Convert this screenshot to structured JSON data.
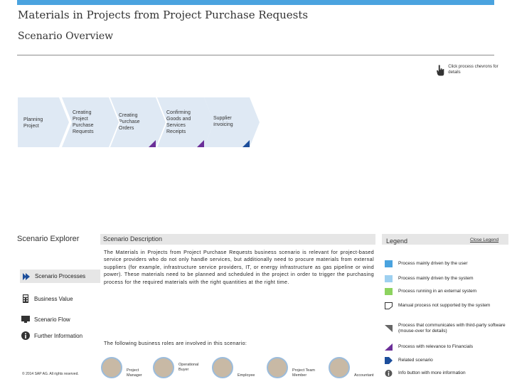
{
  "header": {
    "title": "Materials in Projects from Project Purchase Requests",
    "subtitle": "Scenario Overview",
    "hint": "Click process chevrons for details"
  },
  "flow": {
    "steps": [
      {
        "label": "Planning Project"
      },
      {
        "label": "Creating Project Purchase Requests"
      },
      {
        "label": "Creating Purchase Orders"
      },
      {
        "label": "Confirming Goods and Services Receipts"
      },
      {
        "label": "Supplier Invoicing"
      }
    ]
  },
  "explorer": {
    "title": "Scenario Explorer",
    "items": [
      {
        "label": "Scenario Processes",
        "icon": "arrow-icon"
      },
      {
        "label": "Business Value",
        "icon": "calculator-icon"
      },
      {
        "label": "Scenario Flow",
        "icon": "monitor-icon"
      },
      {
        "label": "Further Information",
        "icon": "info-icon"
      }
    ]
  },
  "description": {
    "heading": "Scenario Description",
    "text": "The Materials in Projects from Project Purchase Requests business scenario is relevant for project-based service providers who do not only handle services, but additionally need to procure materials from external suppliers (for example, infrastructure service providers, IT, or energy infrastructure as gas pipeline or wind power). These materials need to be planned and scheduled in the project in order to trigger the purchasing process for the required materials with the right quantities at the right time.",
    "roles_intro": "The following business roles are involved in this scenario:"
  },
  "roles": [
    {
      "label": "Project Manager"
    },
    {
      "label": "Operational Buyer"
    },
    {
      "label": "Employee"
    },
    {
      "label": "Project Team Member"
    },
    {
      "label": "Accountant"
    }
  ],
  "copyright": "© 2014 SAP AG. All rights reserved.",
  "legend": {
    "title": "Legend",
    "close": "Close Legend",
    "items": [
      {
        "label": "Process mainly driven by the user",
        "color": "#4aa3df"
      },
      {
        "label": "Process mainly driven by the system",
        "color": "#9ed0f0"
      },
      {
        "label": "Process running in an external system",
        "color": "#8dd35f"
      },
      {
        "label": "Manual process not supported by the system",
        "color": "#ffffff"
      },
      {
        "label": "Process that communicates with third-party software (mouse-over for details)",
        "color": "#666666"
      },
      {
        "label": "Process with relevance to Financials",
        "color": "#6b2f98"
      },
      {
        "label": "Related scenario",
        "color": "#1c4e9b"
      },
      {
        "label": "Info button with more information",
        "color": "#555555"
      }
    ]
  }
}
